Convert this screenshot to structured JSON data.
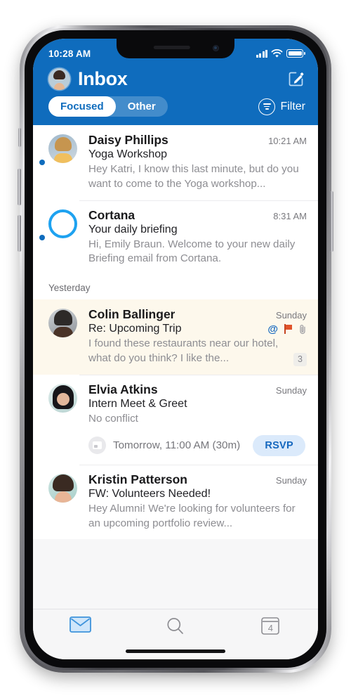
{
  "status_bar": {
    "time": "10:28 AM",
    "signal_icon": "cellular-bars-icon",
    "wifi_icon": "wifi-icon",
    "battery_icon": "battery-full-icon"
  },
  "header": {
    "title": "Inbox",
    "avatar_name": "user-avatar",
    "compose_icon": "compose-icon",
    "tabs": [
      {
        "label": "Focused",
        "active": true
      },
      {
        "label": "Other",
        "active": false
      }
    ],
    "filter": {
      "label": "Filter",
      "icon": "filter-icon"
    },
    "accent_color": "#0f6cbd"
  },
  "groups": [
    {
      "label": "",
      "visible": false
    },
    {
      "label": "Yesterday",
      "visible": true
    }
  ],
  "group_yesterday_label": "Yesterday",
  "messages": [
    {
      "sender": "Daisy Phillips",
      "time": "10:21 AM",
      "subject": "Yoga Workshop",
      "preview": "Hey Katri, I know this last minute, but do you want to come to the Yoga workshop...",
      "unread": true,
      "avatar": "daisy-avatar"
    },
    {
      "sender": "Cortana",
      "time": "8:31 AM",
      "subject": "Your daily briefing",
      "preview": "Hi, Emily Braun. Welcome to your new daily Briefing email from Cortana.",
      "unread": true,
      "avatar": "cortana-ring-icon"
    },
    {
      "sender": "Colin Ballinger",
      "time": "Sunday",
      "subject": "Re: Upcoming Trip",
      "preview": "I found these restaurants near our hotel, what do you think? I like the...",
      "unread": false,
      "highlight": true,
      "avatar": "colin-avatar",
      "flags": {
        "mention_icon": "at-mention-icon",
        "flag_icon": "flag-icon",
        "attachment_icon": "paperclip-icon"
      },
      "thread_count": "3"
    },
    {
      "sender": "Elvia Atkins",
      "time": "Sunday",
      "subject": "Intern Meet & Greet",
      "preview": "No conflict",
      "unread": false,
      "avatar": "elvia-avatar",
      "event": {
        "icon": "calendar-icon",
        "text": "Tomorrow, 11:00 AM (30m)",
        "action_label": "RSVP"
      }
    },
    {
      "sender": "Kristin Patterson",
      "time": "Sunday",
      "subject": "FW: Volunteers Needed!",
      "preview": "Hey Alumni! We're looking for volunteers for an upcoming portfolio review...",
      "unread": false,
      "avatar": "kristin-avatar"
    }
  ],
  "tabbar": [
    {
      "name": "mail-tab",
      "icon": "envelope-icon",
      "active": true
    },
    {
      "name": "search-tab",
      "icon": "search-icon",
      "active": false
    },
    {
      "name": "calendar-tab",
      "icon": "calendar-day-icon",
      "active": false,
      "badge": "4"
    }
  ],
  "calendar_tab_day": "4"
}
